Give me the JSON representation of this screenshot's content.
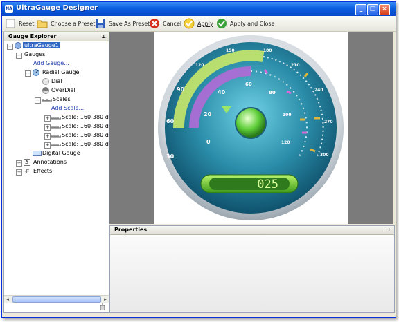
{
  "window": {
    "title": "UltraGauge Designer",
    "icon_text": "NA"
  },
  "toolbar": {
    "reset": "Reset",
    "choose_preset": "Choose a Preset",
    "save_preset": "Save As Preset",
    "cancel": "Cancel",
    "apply": "Apply",
    "apply_close": "Apply and Close"
  },
  "explorer": {
    "title": "Gauge Explorer",
    "root": "ultraGauge1",
    "gauges": "Gauges",
    "add_gauge": "Add Gauge...",
    "radial_gauge": "Radial Gauge",
    "dial": "Dial",
    "overdial": "OverDial",
    "scales": "Scales",
    "add_scale": "Add Scale...",
    "scale_items": [
      "Scale: 160-380 de",
      "Scale: 160-380 de",
      "Scale: 160-380 de",
      "Scale: 160-380 de"
    ],
    "digital_gauge": "Digital Gauge",
    "annotations": "Annotations",
    "effects": "Effects"
  },
  "gauge": {
    "outer_ticks": [
      "30",
      "60",
      "90",
      "120",
      "150",
      "180"
    ],
    "inner_ticks": [
      "0",
      "20",
      "40",
      "60",
      "80",
      "100",
      "120"
    ],
    "right_ticks": [
      "210",
      "240",
      "270",
      "300"
    ],
    "digital_readout": "025"
  },
  "properties": {
    "title": "Properties"
  },
  "colors": {
    "accent": "#316ac5",
    "gauge_teal": "#2a8ca8",
    "lcd_green": "#7ed321"
  }
}
